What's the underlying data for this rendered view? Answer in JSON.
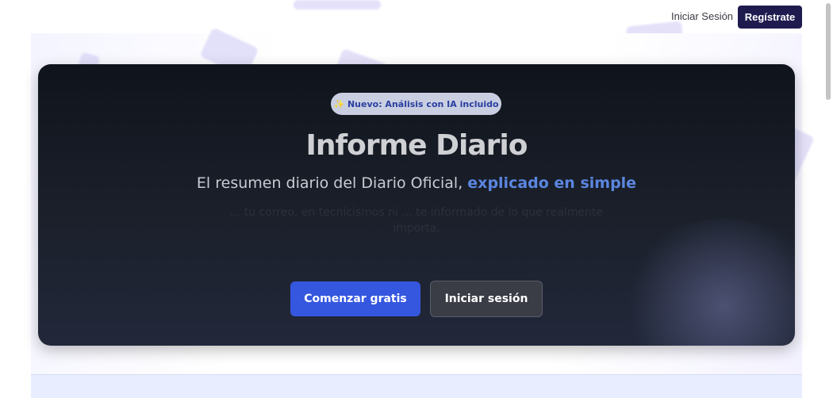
{
  "header": {
    "login_label": "Iniciar Sesión",
    "register_label": "Regístrate"
  },
  "hero": {
    "badge_icon": "sparkles-icon",
    "badge_text": "✨ Nuevo: Análisis con IA incluido",
    "title": "Informe Diario",
    "subtitle_prefix": "El resumen diario del Diario Oficial, ",
    "subtitle_highlight": "explicado en simple",
    "description": "... tu correo, en tecnicismos ni ... te informado de lo que realmente importa.",
    "primary_cta": "Comenzar gratis",
    "secondary_cta": "Iniciar sesión"
  },
  "colors": {
    "brand_dark": "#1f1b4f",
    "accent_blue": "#3557e0",
    "highlight": "#5b86e0"
  }
}
